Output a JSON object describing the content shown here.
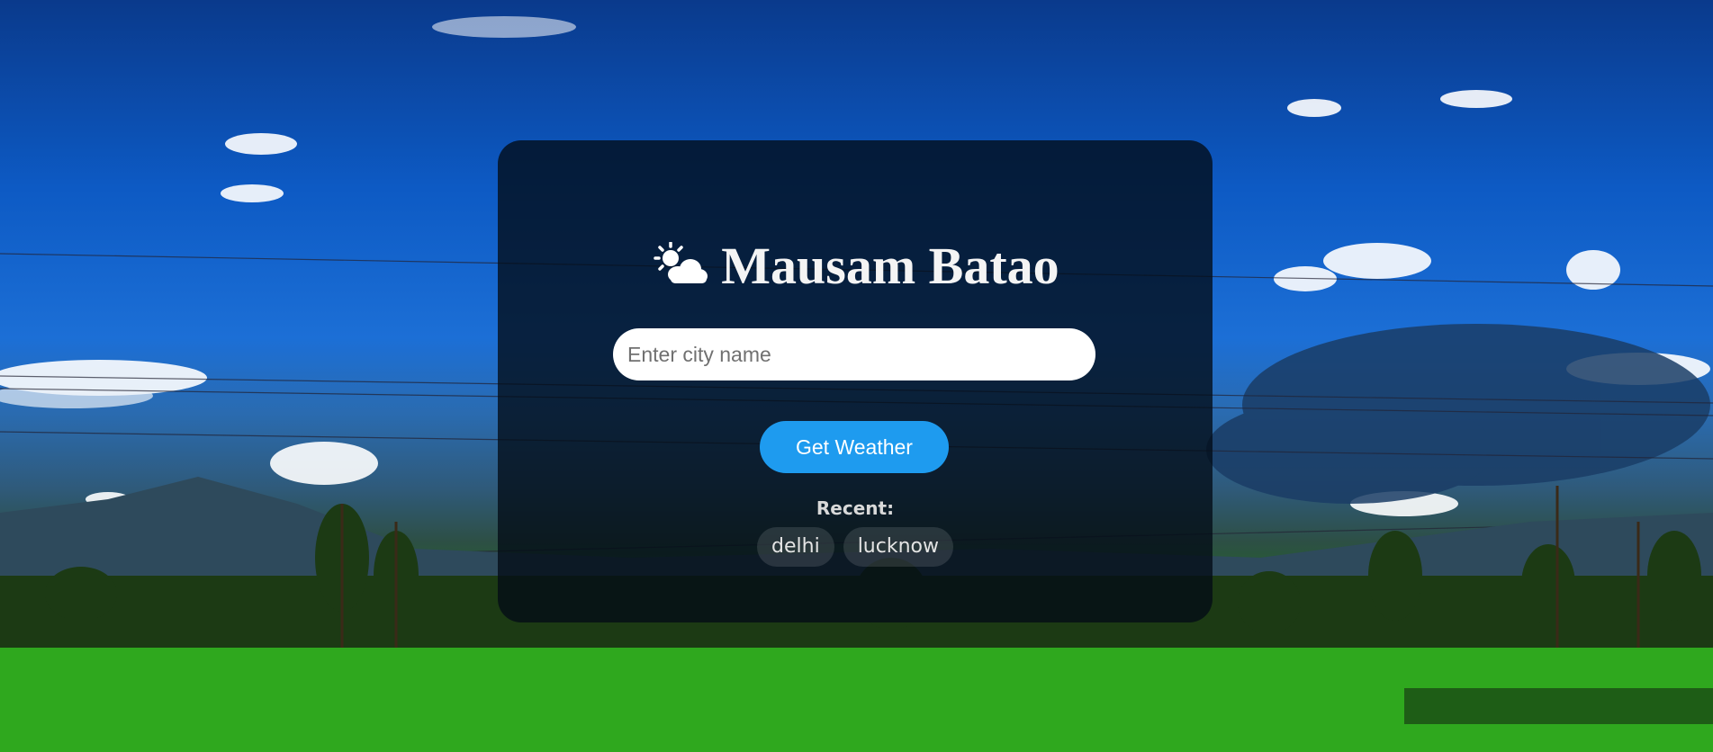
{
  "app": {
    "title": "Mausam Batao",
    "title_icon": "sun-behind-cloud-icon"
  },
  "search": {
    "value": "",
    "placeholder": "Enter city name"
  },
  "actions": {
    "get_weather_label": "Get Weather"
  },
  "recent": {
    "label": "Recent:",
    "items": [
      "delhi",
      "lucknow"
    ]
  },
  "colors": {
    "accent": "#1e9bef",
    "card_background": "rgba(3, 12, 22, 0.78)"
  }
}
